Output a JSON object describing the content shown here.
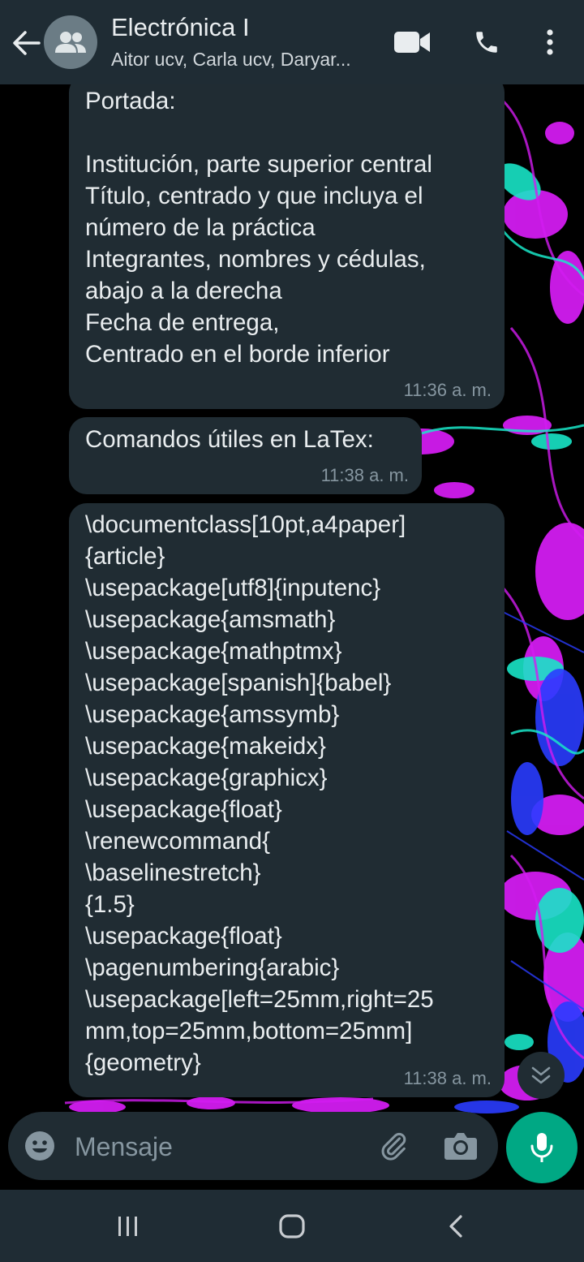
{
  "header": {
    "title": "Electrónica I",
    "subtitle": "Aitor ucv, Carla ucv, Daryar..."
  },
  "messages": [
    {
      "text": "Portada:\n\nInstitución, parte superior central\nTítulo, centrado y que incluya el\nnúmero de la práctica\nIntegrantes, nombres y cédulas,\nabajo a la derecha\nFecha de entrega,\nCentrado en el borde inferior",
      "time": "11:36 a. m."
    },
    {
      "text": "Comandos útiles en LaTex:",
      "time": "11:38 a. m."
    },
    {
      "text": "\\documentclass[10pt,a4paper]\n{article}\n\\usepackage[utf8]{inputenc}\n\\usepackage{amsmath}\n\\usepackage{mathptmx}\n\\usepackage[spanish]{babel}\n\\usepackage{amssymb}\n\\usepackage{makeidx}\n\\usepackage{graphicx}\n\\usepackage{float}\n\\renewcommand{\n\\baselinestretch}\n{1.5}\n\\usepackage{float}\n\\pagenumbering{arabic}\n\\usepackage[left=25mm,right=25\nmm,top=25mm,bottom=25mm]\n{geometry}",
      "time": "11:38 a. m."
    }
  ],
  "composer": {
    "placeholder": "Mensaje"
  },
  "icons": {
    "back": "arrow-left-icon",
    "avatar": "group-icon",
    "video": "video-camera-icon",
    "call": "phone-icon",
    "menu": "more-vert-icon",
    "scroll": "double-chevron-down-icon",
    "emoji": "emoji-icon",
    "attach": "paperclip-icon",
    "camera": "camera-icon",
    "mic": "microphone-icon",
    "nav_recents": "recents-icon",
    "nav_home": "home-icon",
    "nav_back": "nav-back-icon"
  },
  "colors": {
    "header_bg": "#1f2c34",
    "bubble_bg": "#202c33",
    "accent": "#00a884",
    "wallpaper_magenta": "#d21cf0",
    "wallpaper_cyan": "#19e6c8",
    "wallpaper_blue": "#2a3cff"
  }
}
